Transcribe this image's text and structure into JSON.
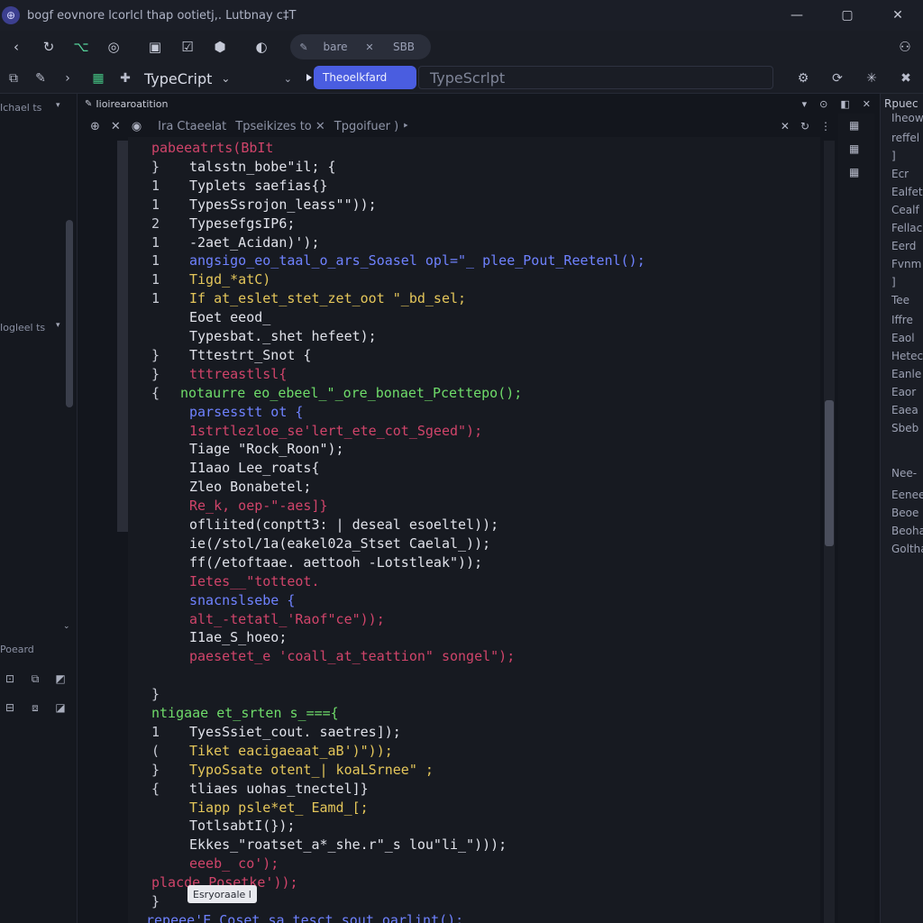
{
  "window": {
    "title": "bogf eovnore lcorlcl thap ootietj,. Lutbnay c‡T",
    "app_badge": "⊕"
  },
  "nav": {
    "search_left": "bare",
    "search_close": "✕",
    "search_right": "SBB"
  },
  "toolbar": {
    "language": "TypeCript",
    "active_tab": "Theoelkfard",
    "tab_text": "TypeScrlpt"
  },
  "sidebar": {
    "section1": "Ichael ts",
    "section2": "Iogleel ts",
    "section3": "Poeard"
  },
  "editor": {
    "tab_title": "Iioirearoatition",
    "path": [
      "Ira Ctaeelat",
      "Tpseikizes to ✕",
      "Tpgoifuer ) ‣"
    ],
    "tooltip": "Esryoraale l",
    "lines": [
      {
        "m": "",
        "t": "pabeeatrts(BbIt",
        "c": "#d0446a",
        "i": 26
      },
      {
        "m": "}",
        "t": "talsstn_bobe\"il; {",
        "c": "#e0e2ea",
        "i": 68
      },
      {
        "m": "1",
        "t": "Typlets saefias{}",
        "c": "#e0e2ea",
        "i": 68
      },
      {
        "m": "1",
        "t": "TypesSsrojon_leass\"\"));",
        "c": "#e0e2ea",
        "i": 68
      },
      {
        "m": "2",
        "t": "TypesefgsIP6;",
        "c": "#e0e2ea",
        "i": 68
      },
      {
        "m": "1",
        "t": "-2aet_Acidan)');",
        "c": "#e0e2ea",
        "i": 68
      },
      {
        "m": "1",
        "t": "angsigo_eo_taal_o_ars_Soasel opl=\"_ plee_Pout_Reetenl();",
        "c": "#6f82ff",
        "i": 68
      },
      {
        "m": "1",
        "t": "Tigd_*atC)",
        "c": "#e4c65a",
        "i": 68
      },
      {
        "m": "1",
        "t": "If at_eslet_stet_zet_oot \"_bd_sel;",
        "c": "#e4c65a",
        "i": 68
      },
      {
        "m": "",
        "t": "Eoet eeod_",
        "c": "#e0e2ea",
        "i": 68
      },
      {
        "m": "",
        "t": "Typesbat._shet hefeet);",
        "c": "#e0e2ea",
        "i": 68
      },
      {
        "m": "}",
        "t": "Tttestrt_Snot {",
        "c": "#e0e2ea",
        "i": 68
      },
      {
        "m": "}",
        "t": "tttreastlsl{",
        "c": "#d0446a",
        "i": 68
      },
      {
        "m": "{",
        "t": "notaurre eo_ebeel_\"_ore_bonaet_Pcettepo();",
        "c": "#6fdc6a",
        "i": 58
      },
      {
        "m": "",
        "t": "parsesstt ot {",
        "c": "#6f82ff",
        "i": 68
      },
      {
        "m": "",
        "t": "1strtlezloe_se'lert_ete_cot_Sgeed\");",
        "c": "#d0446a",
        "i": 68
      },
      {
        "m": "",
        "t": "Tiage \"Rock_Roon\");",
        "c": "#e0e2ea",
        "i": 68
      },
      {
        "m": "",
        "t": "I1aao Lee_roats{",
        "c": "#e0e2ea",
        "i": 68
      },
      {
        "m": "",
        "t": "Zleo Bonabetel;",
        "c": "#e0e2ea",
        "i": 68
      },
      {
        "m": "",
        "t": "Re_k, oep-\"-aes]}",
        "c": "#d0446a",
        "i": 68
      },
      {
        "m": "",
        "t": "ofliited(conptt3: | deseal esoeltel));",
        "c": "#e0e2ea",
        "i": 68
      },
      {
        "m": "",
        "t": "ie(/stol/1a(eakel02a_Stset Caelal_));",
        "c": "#e0e2ea",
        "i": 68
      },
      {
        "m": "",
        "t": "ff(/etoftaae. aettooh -Lotstleak\"));",
        "c": "#e0e2ea",
        "i": 68
      },
      {
        "m": "",
        "t": "Ietes__\"totteot.",
        "c": "#d0446a",
        "i": 68
      },
      {
        "m": "",
        "t": "snacnslsebe {",
        "c": "#6f82ff",
        "i": 68
      },
      {
        "m": "",
        "t": "alt_-tetatl_'Raof\"ce\"));",
        "c": "#d0446a",
        "i": 68
      },
      {
        "m": "",
        "t": "I1ae_S_hoeo;",
        "c": "#e0e2ea",
        "i": 68
      },
      {
        "m": "",
        "t": "paesetet_e 'coall_at_teattion\" songel\");",
        "c": "#d0446a",
        "i": 68
      },
      {
        "m": "",
        "t": "",
        "c": "#e0e2ea",
        "i": 68
      },
      {
        "m": "}",
        "t": "",
        "c": "#e0e2ea",
        "i": 68
      },
      {
        "m": "",
        "t": "ntigaae et_srten s_==={",
        "c": "#6fdc6a",
        "i": 26
      },
      {
        "m": "1",
        "t": "TyesSsiet_cout. saetres]);",
        "c": "#e0e2ea",
        "i": 68
      },
      {
        "m": "(",
        "t": "Tiket eacigaeaat_aB')\"));",
        "c": "#e4c65a",
        "i": 68
      },
      {
        "m": "}",
        "t": "TypoSsate otent_| koaLSrnee\" ;",
        "c": "#e4c65a",
        "i": 68
      },
      {
        "m": "{",
        "t": "tliaes uohas_tnectel]}",
        "c": "#e0e2ea",
        "i": 68
      },
      {
        "m": "",
        "t": "Tiapp psle*et_ Eamd_[;",
        "c": "#e4c65a",
        "i": 68
      },
      {
        "m": "",
        "t": "TotlsabtI(});",
        "c": "#e0e2ea",
        "i": 68
      },
      {
        "m": "",
        "t": "Ekkes_\"roatset_a*_she.r\"_s lou\"li_\")));",
        "c": "#e0e2ea",
        "i": 68
      },
      {
        "m": "",
        "t": "eeeb_ co');",
        "c": "#d0446a",
        "i": 68
      },
      {
        "m": "",
        "t": "placde_Posetke'));",
        "c": "#d0446a",
        "i": 26
      },
      {
        "m": "}",
        "t": "",
        "c": "#e0e2ea",
        "i": 68
      },
      {
        "m": "",
        "t": "repeee'E Coset sa_tesct_sout oarlint();",
        "c": "#6f82ff",
        "i": 20
      }
    ]
  },
  "right_panel": {
    "title": "Rpuec",
    "items": [
      "Iheow",
      "reffel",
      "]",
      "Ecr",
      "Ealfet",
      "Cealf",
      "Fellac",
      "Eerd",
      "Fvnm",
      "]",
      "Tee",
      "Iffre",
      "Eaol",
      "Hetec",
      "Eanle",
      "Eaor",
      "Eaea",
      "Sbeb",
      "Nee-",
      "Eenee",
      "Beoe",
      "Beoha",
      "Goltha"
    ]
  }
}
